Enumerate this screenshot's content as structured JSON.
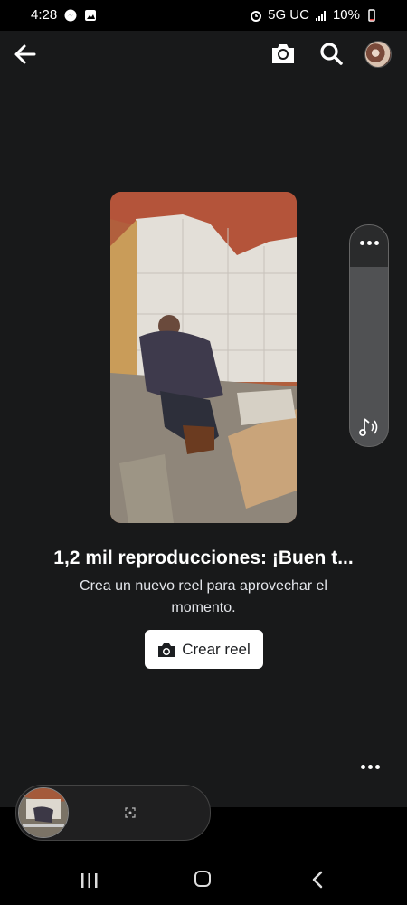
{
  "status_bar": {
    "time": "4:28",
    "network": "5G UC",
    "battery": "10%"
  },
  "app_bar": {
    "back_icon": "arrow-left-icon",
    "camera_icon": "camera-icon",
    "search_icon": "search-icon",
    "avatar": "profile-avatar"
  },
  "reel": {
    "thumbnail": "video-thumbnail",
    "side_panel": {
      "more_icon": "more-horizontal-icon",
      "sound_icon": "sound-icon"
    }
  },
  "content": {
    "title": "1,2 mil reproducciones: ¡Buen t...",
    "subtitle": "Crea un nuevo reel para aprovechar el momento.",
    "button_label": "Crear reel"
  },
  "colors": {
    "background": "#18191a",
    "button_bg": "#ffffff",
    "button_text": "#1c1e21",
    "status_bar": "#000000"
  }
}
